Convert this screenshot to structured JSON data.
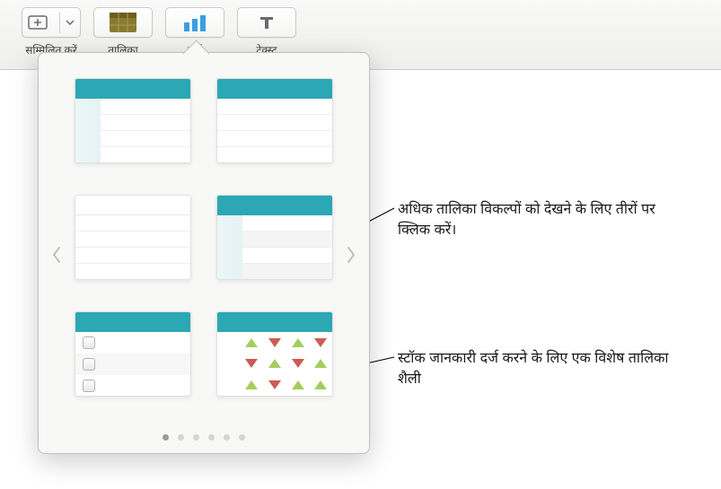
{
  "toolbar": {
    "insert_label": "सम्मिलित करें",
    "table_label": "तालिका",
    "chart_label": "चार्ट",
    "text_label": "टेक्स्ट"
  },
  "icons": {
    "insert": "plus-box",
    "table": "table-grid",
    "chart": "bar-chart",
    "text": "text-T",
    "chevron_down": "chevron-down",
    "chevron_left": "chevron-left",
    "chevron_right": "chevron-right"
  },
  "popover": {
    "page_count": 6,
    "active_page": 1,
    "styles": [
      {
        "id": "header-leftcol",
        "desc": "teal header with left column"
      },
      {
        "id": "header-plain",
        "desc": "teal header plain rows"
      },
      {
        "id": "minimal",
        "desc": "no header minimal"
      },
      {
        "id": "header-leftcol-striped",
        "desc": "teal header left column striped"
      },
      {
        "id": "checklist",
        "desc": "teal header with checkboxes"
      },
      {
        "id": "stock",
        "desc": "teal header stock triangles"
      }
    ]
  },
  "callouts": {
    "arrows_text": "अधिक तालिका विकल्पों को देखने के लिए तीरों पर क्लिक करें।",
    "stock_text": "स्टॉक जानकारी दर्ज करने के लिए एक विशेष तालिका शैली"
  },
  "colors": {
    "accent": "#2ba8b3",
    "table_active": "#8a7a2f"
  }
}
